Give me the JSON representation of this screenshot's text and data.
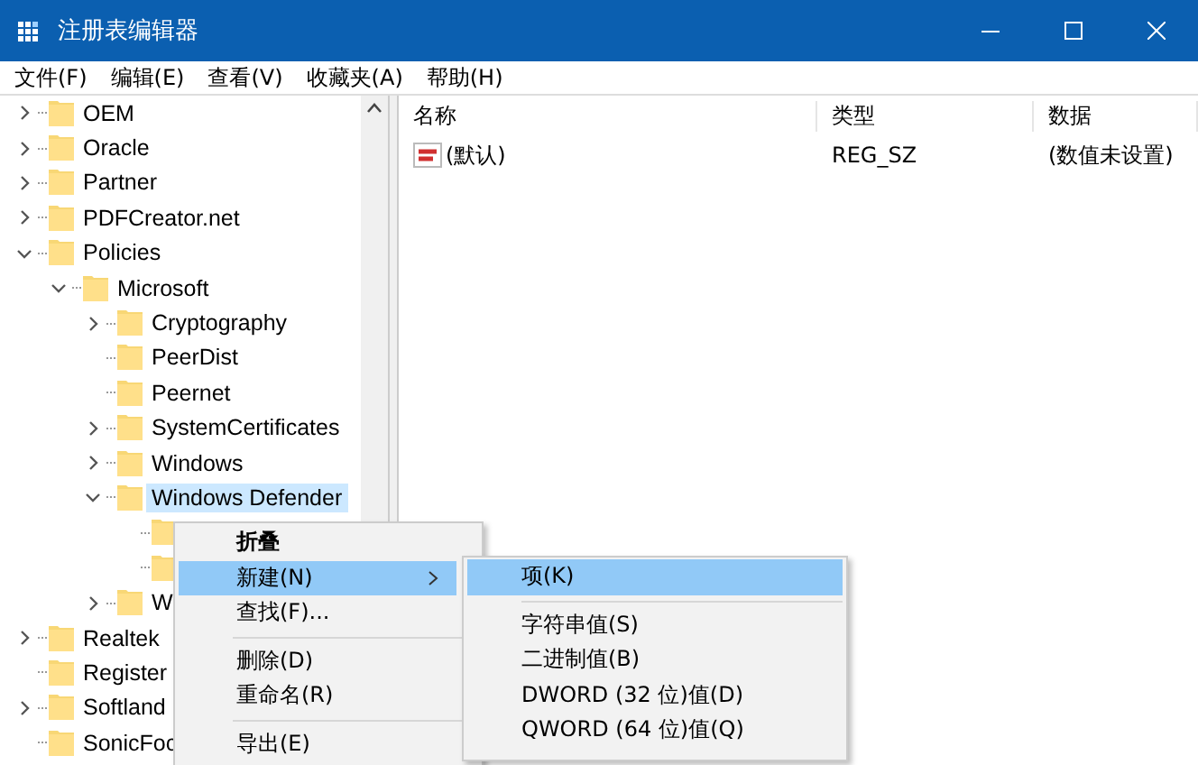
{
  "window": {
    "title": "注册表编辑器"
  },
  "menu_bar": [
    "文件(F)",
    "编辑(E)",
    "查看(V)",
    "收藏夹(A)",
    "帮助(H)"
  ],
  "tree": [
    {
      "kind": "folder",
      "label": "OEM",
      "expanded": false
    },
    {
      "kind": "folder",
      "label": "Oracle",
      "expanded": false
    },
    {
      "kind": "folder",
      "label": "Partner",
      "expanded": false
    },
    {
      "kind": "folder",
      "label": "PDFCreator.net",
      "expanded": false
    },
    {
      "kind": "folder",
      "label": "Policies",
      "expanded": true,
      "children": [
        {
          "kind": "folder",
          "label": "Microsoft",
          "expanded": true,
          "children": [
            {
              "kind": "folder",
              "label": "Cryptography",
              "expanded": false
            },
            {
              "kind": "folder",
              "label": "PeerDist"
            },
            {
              "kind": "folder",
              "label": "Peernet"
            },
            {
              "kind": "folder",
              "label": "SystemCertificates",
              "expanded": false
            },
            {
              "kind": "folder",
              "label": "Windows",
              "expanded": false
            },
            {
              "kind": "folder",
              "label": "Windows Defender",
              "expanded": true,
              "selected": true,
              "children": [
                {
                  "kind": "folder"
                },
                {
                  "kind": "folder"
                }
              ]
            },
            {
              "kind": "folder",
              "label": "W",
              "expanded": false
            }
          ]
        }
      ]
    },
    {
      "kind": "folder",
      "label": "Realtek",
      "expanded": false
    },
    {
      "kind": "folder",
      "label": "Register"
    },
    {
      "kind": "folder",
      "label": "Softland",
      "expanded": false
    },
    {
      "kind": "folder",
      "label": "SonicFoc"
    }
  ],
  "table": {
    "columns": [
      "名称",
      "类型",
      "数据"
    ],
    "rows": [
      {
        "name": "(默认)",
        "type": "REG_SZ",
        "data": "(数值未设置)"
      }
    ]
  },
  "context_menu": [
    {
      "kind": "item",
      "label": "折叠",
      "default": true,
      "selected": false
    },
    {
      "kind": "item",
      "label": "新建(N)",
      "submenu": true,
      "selected": true
    },
    {
      "kind": "item",
      "label": "查找(F)...",
      "selected": false
    },
    {
      "kind": "separator"
    },
    {
      "kind": "item",
      "label": "删除(D)",
      "selected": false
    },
    {
      "kind": "item",
      "label": "重命名(R)",
      "selected": false
    },
    {
      "kind": "separator"
    },
    {
      "kind": "item",
      "label": "导出(E)",
      "selected": false
    }
  ],
  "submenu": [
    {
      "kind": "item",
      "label": "项(K)",
      "selected": true
    },
    {
      "kind": "separator"
    },
    {
      "kind": "item",
      "label": "字符串值(S)",
      "selected": false
    },
    {
      "kind": "item",
      "label": "二进制值(B)",
      "selected": false
    },
    {
      "kind": "item",
      "label": "DWORD (32 位)值(D)",
      "selected": false
    },
    {
      "kind": "item",
      "label": "QWORD (64 位)值(Q)",
      "selected": false
    }
  ]
}
